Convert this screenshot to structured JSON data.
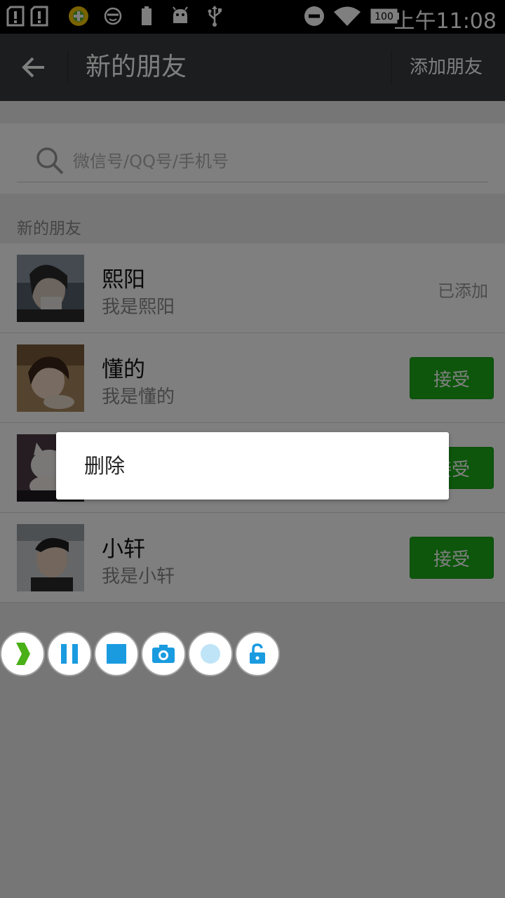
{
  "status_bar": {
    "battery_level": "100",
    "time": "上午11:08"
  },
  "toolbar": {
    "title": "新的朋友",
    "action_label": "添加朋友"
  },
  "search": {
    "placeholder": "微信号/QQ号/手机号"
  },
  "section": {
    "header": "新的朋友"
  },
  "friends": [
    {
      "name": "熙阳",
      "message": "我是熙阳",
      "status": "已添加"
    },
    {
      "name": "懂的",
      "message": "我是懂的",
      "action_label": "接受"
    },
    {
      "name": "",
      "message": "",
      "action_label": "接受"
    },
    {
      "name": "小轩",
      "message": "我是小轩",
      "action_label": "接受"
    }
  ],
  "context_menu": {
    "items": [
      {
        "label": "删除"
      }
    ]
  },
  "floating_toolbar": {
    "buttons": [
      "next-icon",
      "pause-icon",
      "stop-icon",
      "camera-icon",
      "record-icon",
      "unlock-icon"
    ]
  },
  "colors": {
    "toolbar_bg": "#393a3f",
    "accept_green": "#1aad19",
    "float_blue": "#1a9be0"
  }
}
